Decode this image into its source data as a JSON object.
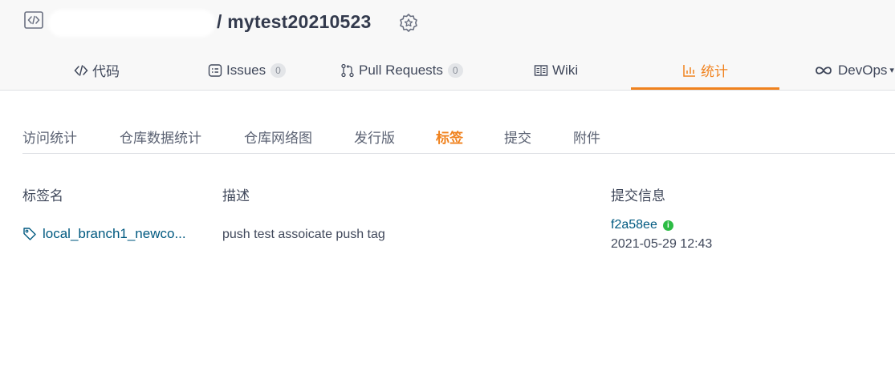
{
  "header": {
    "repo_name": "mytest20210523",
    "separator": "/"
  },
  "tabs": [
    {
      "label": "代码",
      "icon": "code-icon"
    },
    {
      "label": "Issues",
      "icon": "issues-icon",
      "count": "0"
    },
    {
      "label": "Pull Requests",
      "icon": "pull-request-icon",
      "count": "0"
    },
    {
      "label": "Wiki",
      "icon": "wiki-icon"
    },
    {
      "label": "统计",
      "icon": "stats-icon",
      "active": true
    },
    {
      "label": "DevOps",
      "icon": "infinity-icon"
    }
  ],
  "subnav": [
    {
      "label": "访问统计"
    },
    {
      "label": "仓库数据统计"
    },
    {
      "label": "仓库网络图"
    },
    {
      "label": "发行版"
    },
    {
      "label": "标签",
      "active": true
    },
    {
      "label": "提交"
    },
    {
      "label": "附件"
    }
  ],
  "table": {
    "headers": [
      "标签名",
      "描述",
      "提交信息"
    ],
    "rows": [
      {
        "tag_name": "local_branch1_newco...",
        "description": "push test assoicate push tag",
        "commit_sha": "f2a58ee",
        "commit_time": "2021-05-29 12:43"
      }
    ]
  },
  "colors": {
    "accent": "#f0821e",
    "link": "#005980",
    "verified": "#2dbc45"
  }
}
